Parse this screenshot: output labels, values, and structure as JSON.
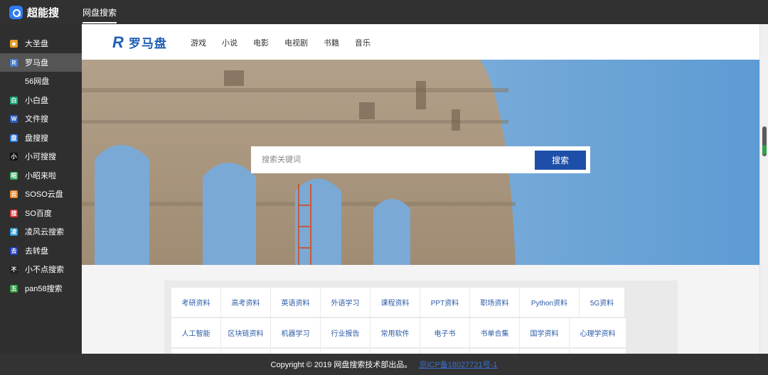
{
  "app": {
    "brand_name": "超能搜",
    "top_tab": "网盘搜索"
  },
  "sidebar": {
    "items": [
      {
        "label": "大圣盘",
        "icon": "monkey-king-icon",
        "icon_color": "#e79b2b",
        "glyph": "◆"
      },
      {
        "label": "罗马盘",
        "icon": "luoma-r-icon",
        "icon_color": "#4a7fd0",
        "glyph": "R",
        "active": true
      },
      {
        "label": "56网盘",
        "icon": "",
        "icon_color": "",
        "glyph": ""
      },
      {
        "label": "小白盘",
        "icon": "xiaobai-icon",
        "icon_color": "#1aa37a",
        "glyph": "白"
      },
      {
        "label": "文件搜",
        "icon": "w-letter-icon",
        "icon_color": "#2c5fbf",
        "glyph": "W"
      },
      {
        "label": "盘搜搜",
        "icon": "pansoso-icon",
        "icon_color": "#2a7be0",
        "glyph": "盘"
      },
      {
        "label": "小可搜搜",
        "icon": "xiaoke-icon",
        "icon_color": "#111111",
        "glyph": "小"
      },
      {
        "label": "小昭来啦",
        "icon": "xiaozhao-icon",
        "icon_color": "#3aa860",
        "glyph": "昭"
      },
      {
        "label": "SOSO云盘",
        "icon": "soso-icon",
        "icon_color": "#e98a2a",
        "glyph": "云"
      },
      {
        "label": "SO百度",
        "icon": "so-baidu-icon",
        "icon_color": "#d93030",
        "glyph": "搜"
      },
      {
        "label": "凌风云搜索",
        "icon": "lingfeng-icon",
        "icon_color": "#2a9ad6",
        "glyph": "凌"
      },
      {
        "label": "去转盘",
        "icon": "quzhuan-icon",
        "icon_color": "#1f3fc0",
        "glyph": "去"
      },
      {
        "label": "小不点搜索",
        "icon": "xiaobudian-icon",
        "icon_color": "#222222",
        "glyph": "不"
      },
      {
        "label": "pan58搜索",
        "icon": "pan58-icon",
        "icon_color": "#2e9a3a",
        "glyph": "五"
      }
    ]
  },
  "site": {
    "logo_mark": "R",
    "logo_text": "罗马盘",
    "nav": [
      "游戏",
      "小说",
      "电影",
      "电视剧",
      "书籍",
      "音乐"
    ],
    "search_placeholder": "搜索关键词",
    "search_button": "搜索",
    "tags_row1": [
      "考研资料",
      "高考资料",
      "英语资料",
      "外语学习",
      "课程资料",
      "PPT资料",
      "职场资料",
      "Python资料",
      "5G资料"
    ],
    "tags_row2": [
      "人工智能",
      "区块链资料",
      "机器学习",
      "行业报告",
      "常用软件",
      "电子书",
      "书单合集",
      "国学资料",
      "心理学资料"
    ]
  },
  "footer": {
    "copyright": "Copyright © 2019 网盘搜索技术部出品。",
    "icp": "京ICP备18027721号-1"
  },
  "colors": {
    "accent": "#1e4fa8",
    "sidebar_bg": "#2f2f2f",
    "active_item_bg": "#555555"
  }
}
